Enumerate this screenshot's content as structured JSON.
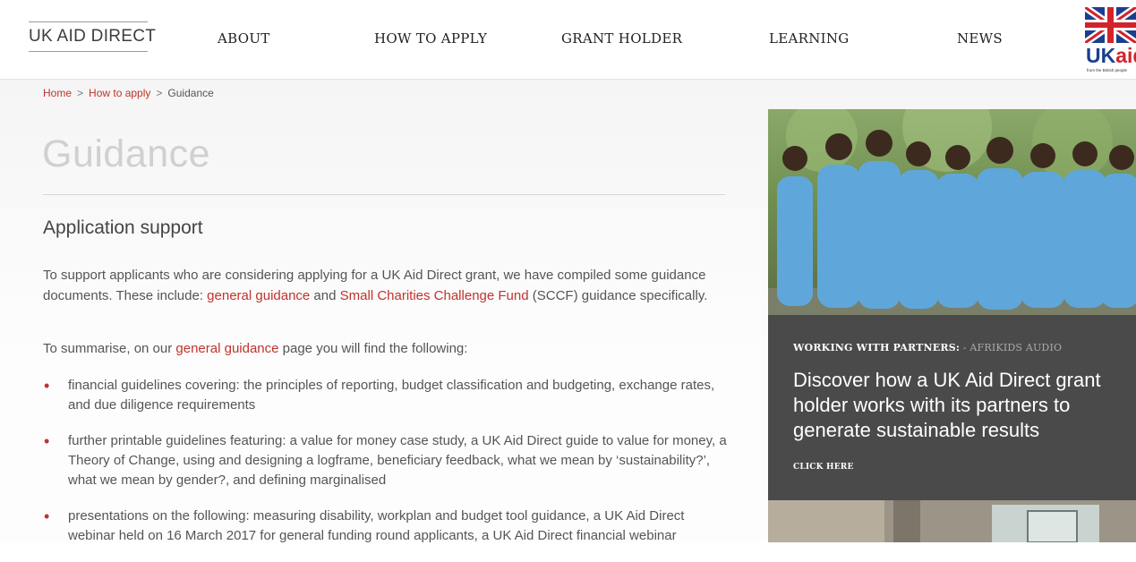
{
  "header": {
    "brand": "UK AID DIRECT",
    "nav": [
      "ABOUT",
      "HOW TO APPLY",
      "GRANT HOLDER",
      "LEARNING",
      "NEWS"
    ],
    "logo": {
      "uk": "UK",
      "aid": "aid",
      "tagline": "from the British people"
    }
  },
  "breadcrumb": {
    "home": "Home",
    "sep": ">",
    "how": "How to apply",
    "current": "Guidance"
  },
  "page": {
    "title": "Guidance"
  },
  "section": {
    "title": "Application support",
    "intro": {
      "t1": "To support applicants who are considering applying for a UK Aid Direct grant, we have compiled some guidance documents. These include: ",
      "link1": "general guidance",
      "t2": " and ",
      "link2": "Small Charities Challenge Fund",
      "t3": " (SCCF) guidance specifically."
    },
    "summary": {
      "t1": "To summarise, on our ",
      "link": "general guidance",
      "t2": " page you will find the following:"
    },
    "bullets": [
      "financial guidelines covering: the principles of reporting, budget classification and budgeting, exchange rates, and due diligence requirements",
      "further printable guidelines featuring: a value for money case study, a UK Aid Direct guide to value for money, a Theory of Change, using and designing a logframe, beneficiary feedback, what we mean by ‘sustainability?’, what we mean by gender?, and defining marginalised",
      "presentations on the following: measuring disability, workplan and budget tool guidance, a UK Aid Direct webinar held on 16 March 2017 for general funding round applicants, a UK Aid Direct financial webinar"
    ]
  },
  "sidebar": {
    "promo": {
      "kicker": "WORKING WITH PARTNERS:",
      "source": " - AFRIKIDS AUDIO",
      "headline": "Discover how a UK Aid Direct grant holder works with its partners to generate sustainable results",
      "cta": "CLICK HERE"
    }
  },
  "colors": {
    "accent": "#c0332d",
    "promo_bg": "#4a4a4a",
    "flag_blue": "#1b3f8f",
    "flag_red": "#d2232a"
  }
}
